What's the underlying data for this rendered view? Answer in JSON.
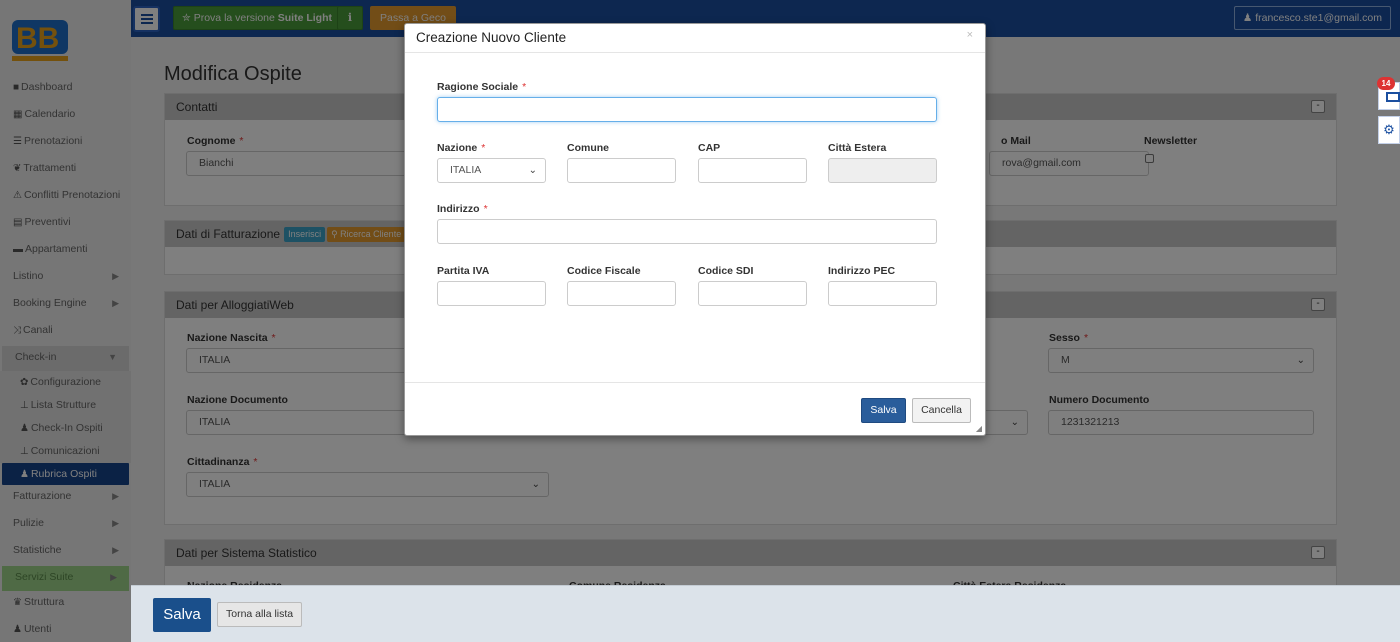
{
  "topbar": {
    "suite_label_prefix": "Prova la versione",
    "suite_label_strong": "Suite Light",
    "geco_label": "Passa a Geco",
    "user_email": "francesco.ste1@gmail.com"
  },
  "sidebar": {
    "items": [
      {
        "label": "Dashboard",
        "icon": "■"
      },
      {
        "label": "Calendario",
        "icon": "▦"
      },
      {
        "label": "Prenotazioni",
        "icon": "☰"
      },
      {
        "label": "Trattamenti",
        "icon": "❦"
      },
      {
        "label": "Conflitti Prenotazioni",
        "icon": "⚠"
      },
      {
        "label": "Preventivi",
        "icon": "▤"
      },
      {
        "label": "Appartamenti",
        "icon": "▬"
      },
      {
        "label": "Listino",
        "icon": ""
      },
      {
        "label": "Booking Engine",
        "icon": ""
      },
      {
        "label": "Canali",
        "icon": "⤨"
      },
      {
        "label": "Check-in",
        "icon": ""
      },
      {
        "label": "Configurazione",
        "icon": "✿"
      },
      {
        "label": "Lista Strutture",
        "icon": "⊥"
      },
      {
        "label": "Check-In Ospiti",
        "icon": "♟"
      },
      {
        "label": "Comunicazioni",
        "icon": "⊥"
      },
      {
        "label": "Rubrica Ospiti",
        "icon": "♟"
      },
      {
        "label": "Fatturazione",
        "icon": ""
      },
      {
        "label": "Pulizie",
        "icon": ""
      },
      {
        "label": "Statistiche",
        "icon": ""
      },
      {
        "label": "Servizi Suite",
        "icon": ""
      },
      {
        "label": "Struttura",
        "icon": "♛"
      },
      {
        "label": "Utenti",
        "icon": "♟"
      }
    ]
  },
  "page": {
    "title": "Modifica Ospite",
    "contatti": {
      "title": "Contatti",
      "cognome_label": "Cognome",
      "cognome_value": "Bianchi",
      "mail_label": "o Mail",
      "mail_value": "rova@gmail.com",
      "newsletter_label": "Newsletter"
    },
    "fatturazione": {
      "title": "Dati di Fatturazione",
      "inserisci": "Inserisci",
      "ricerca": "Ricerca Cliente"
    },
    "alloggiati": {
      "title": "Dati per AlloggiatiWeb",
      "nazione_nascita_label": "Nazione Nascita",
      "nazione_nascita_value": "ITALIA",
      "sesso_label": "Sesso",
      "sesso_value": "M",
      "nazione_doc_label": "Nazione Documento",
      "nazione_doc_value": "ITALIA",
      "numero_doc_label": "Numero Documento",
      "numero_doc_value": "1231321213",
      "cittadinanza_label": "Cittadinanza",
      "cittadinanza_value": "ITALIA"
    },
    "statistico": {
      "title": "Dati per Sistema Statistico",
      "nazione_residenza": "Nazione Residenza",
      "comune_residenza": "Comune Residenza",
      "citta_estera_residenza": "Città Estera Residenza"
    },
    "salva": "Salva",
    "torna": "Torna alla lista"
  },
  "floating": {
    "badge": "14"
  },
  "modal": {
    "title": "Creazione Nuovo Cliente",
    "close": "×",
    "ragione_sociale": "Ragione Sociale",
    "nazione": "Nazione",
    "nazione_value": "ITALIA",
    "comune": "Comune",
    "cap": "CAP",
    "citta_estera": "Città Estera",
    "indirizzo": "Indirizzo",
    "partita_iva": "Partita IVA",
    "codice_fiscale": "Codice Fiscale",
    "codice_sdi": "Codice SDI",
    "indirizzo_pec": "Indirizzo PEC",
    "salva": "Salva",
    "cancella": "Cancella"
  }
}
